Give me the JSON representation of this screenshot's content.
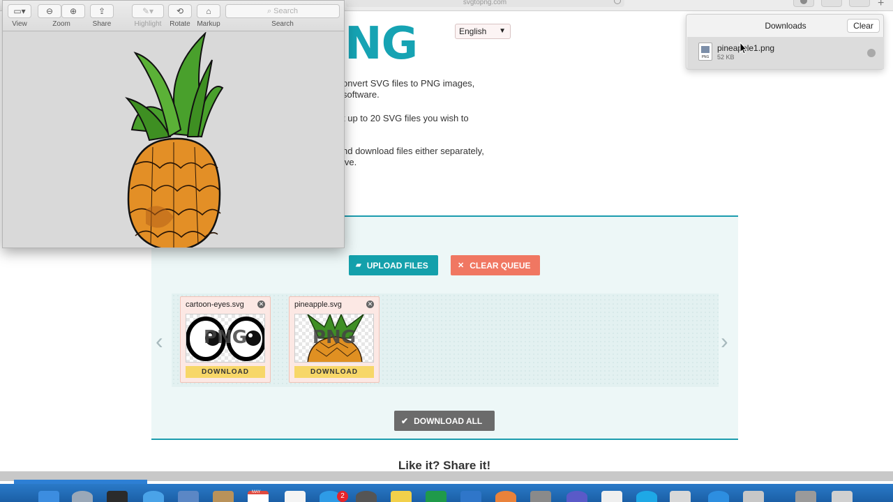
{
  "browser": {
    "url": "svgtopng.com"
  },
  "page": {
    "logo_text": "NG",
    "language": "English",
    "intro": {
      "line1": "onvert SVG files to PNG images,",
      "line2": "software.",
      "line3": "t up to 20 SVG files you wish to",
      "line4": "nd download files either separately,",
      "line5": "ive."
    },
    "upload_label": "UPLOAD FILES",
    "clear_queue_label": "CLEAR QUEUE",
    "prev_arrow": "‹",
    "next_arrow": "›",
    "files": [
      {
        "name": "cartoon-eyes.svg",
        "thumb_text": "PNG",
        "download_label": "DOWNLOAD"
      },
      {
        "name": "pineapple.svg",
        "thumb_text": "PNG",
        "download_label": "DOWNLOAD"
      }
    ],
    "download_all_label": "DOWNLOAD ALL",
    "share_title": "Like it? Share it!"
  },
  "downloads_popover": {
    "title": "Downloads",
    "clear_label": "Clear",
    "item": {
      "filename": "pineapple1.png",
      "size": "52 KB",
      "file_type": "PNG"
    }
  },
  "preview_window": {
    "toolbar": {
      "view": "View",
      "zoom": "Zoom",
      "share": "Share",
      "highlight": "Highlight",
      "rotate": "Rotate",
      "markup": "Markup",
      "search_label": "Search",
      "search_placeholder": "Search"
    }
  },
  "dock": {
    "badge_count": "2",
    "calendar_month": "MAY"
  },
  "colors": {
    "brand_teal": "#16a3b3",
    "clear_queue": "#f07762",
    "download_yellow": "#f7d768",
    "dock_blue": "#1b5fa6"
  }
}
